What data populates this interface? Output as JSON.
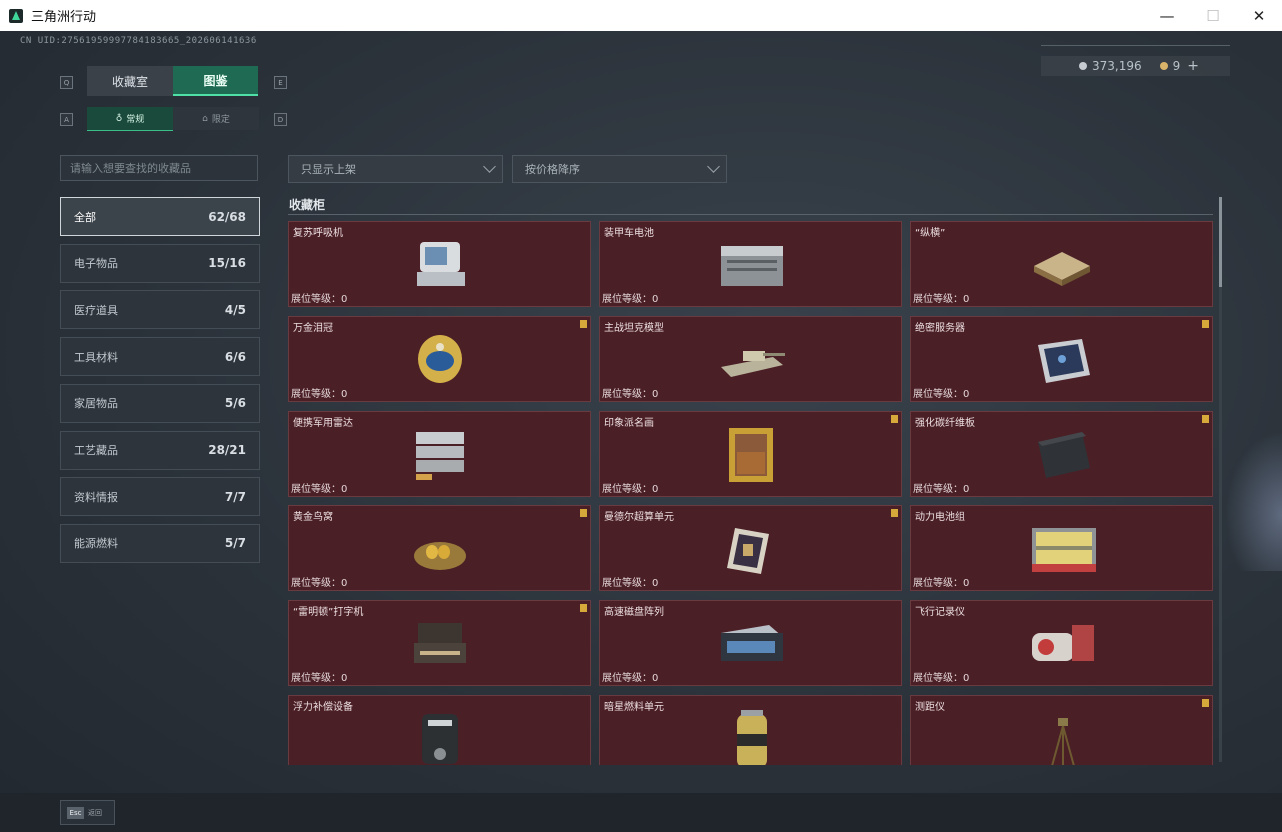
{
  "window": {
    "title": "三角洲行动",
    "controls": [
      "—",
      "☐",
      "✕"
    ]
  },
  "uid": "CN UID:2756195999778418366​5_202606141636",
  "currency": {
    "silver": "373,196",
    "gold": "9",
    "plus": "+"
  },
  "keys": {
    "left_tab": "Q",
    "right_tab": "E",
    "left_sub": "A",
    "right_sub": "D"
  },
  "tabs": {
    "collection_room": "收藏室",
    "catalog": "图鉴"
  },
  "subtabs": {
    "regular": "常规",
    "limited": "限定"
  },
  "search": {
    "placeholder": "请输入想要查找的收藏品"
  },
  "filters": {
    "shelf": "只显示上架",
    "sort": "按价格降序"
  },
  "categories": [
    {
      "label": "全部",
      "count": "62/68"
    },
    {
      "label": "电子物品",
      "count": "15/16"
    },
    {
      "label": "医疗道具",
      "count": "4/5"
    },
    {
      "label": "工具材料",
      "count": "6/6"
    },
    {
      "label": "家居物品",
      "count": "5/6"
    },
    {
      "label": "工艺藏品",
      "count": "28/21"
    },
    {
      "label": "资料情报",
      "count": "7/7"
    },
    {
      "label": "能源燃料",
      "count": "5/7"
    }
  ],
  "section_title": "收藏柜",
  "level_label": "展位等级：",
  "items": [
    {
      "name": "复苏呼吸机",
      "level": "0",
      "badge": false,
      "icon": "ventilator-icon"
    },
    {
      "name": "装甲车电池",
      "level": "0",
      "badge": false,
      "icon": "battery-icon"
    },
    {
      "name": "“纵横”",
      "level": "0",
      "badge": false,
      "icon": "chessboard-icon"
    },
    {
      "name": "万金泪冠",
      "level": "0",
      "badge": true,
      "icon": "jeweled-egg-icon"
    },
    {
      "name": "主战坦克模型",
      "level": "0",
      "badge": false,
      "icon": "tank-model-icon"
    },
    {
      "name": "绝密服务器",
      "level": "0",
      "badge": true,
      "icon": "server-icon"
    },
    {
      "name": "便携军用雷达",
      "level": "0",
      "badge": false,
      "icon": "radar-icon"
    },
    {
      "name": "印象派名画",
      "level": "0",
      "badge": true,
      "icon": "painting-icon"
    },
    {
      "name": "强化碳纤维板",
      "level": "0",
      "badge": true,
      "icon": "carbon-plate-icon"
    },
    {
      "name": "黄金鸟窝",
      "level": "0",
      "badge": true,
      "icon": "golden-nest-icon"
    },
    {
      "name": "曼德尔超算单元",
      "level": "0",
      "badge": true,
      "icon": "compute-unit-icon"
    },
    {
      "name": "动力电池组",
      "level": "0",
      "badge": false,
      "icon": "battery-pack-icon"
    },
    {
      "name": "“雷明顿”打字机",
      "level": "0",
      "badge": true,
      "icon": "typewriter-icon"
    },
    {
      "name": "高速磁盘阵列",
      "level": "0",
      "badge": false,
      "icon": "disk-array-icon"
    },
    {
      "name": "飞行记录仪",
      "level": "0",
      "badge": false,
      "icon": "flight-recorder-icon"
    },
    {
      "name": "浮力补偿设备",
      "level": "",
      "badge": false,
      "icon": "bcd-icon"
    },
    {
      "name": "暗星燃料单元",
      "level": "",
      "badge": false,
      "icon": "fuel-cell-icon"
    },
    {
      "name": "测距仪",
      "level": "",
      "badge": true,
      "icon": "rangefinder-icon"
    }
  ],
  "footer": {
    "esc_key": "Esc",
    "esc_label": "返回"
  },
  "colors": {
    "card_bg": "#4b1f26",
    "accent": "#1f6a52",
    "badge": "#d6a93a"
  }
}
